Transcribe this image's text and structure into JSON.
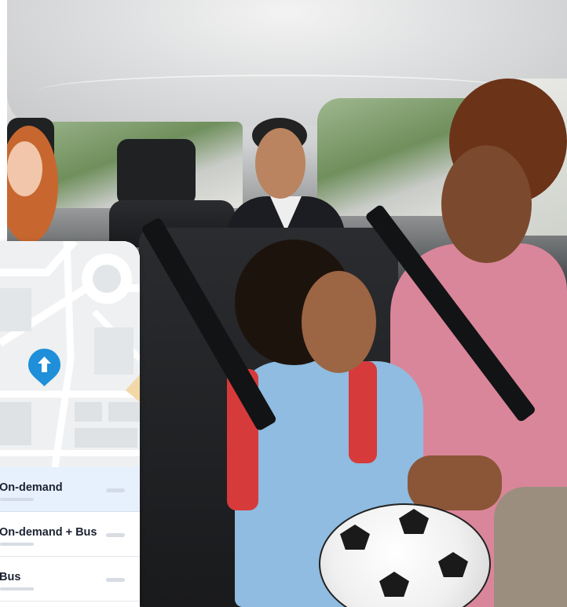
{
  "photo": {
    "description_icon": "car-interior-photo"
  },
  "map": {
    "pin_icon": "arrow-up-icon",
    "pin_color": "#1e8fd8"
  },
  "options": [
    {
      "label": "On-demand",
      "selected": true
    },
    {
      "label": "On-demand + Bus",
      "selected": false
    },
    {
      "label": "Bus",
      "selected": false
    }
  ],
  "colors": {
    "selected_row": "#e7f0fd",
    "text": "#1b2230"
  }
}
